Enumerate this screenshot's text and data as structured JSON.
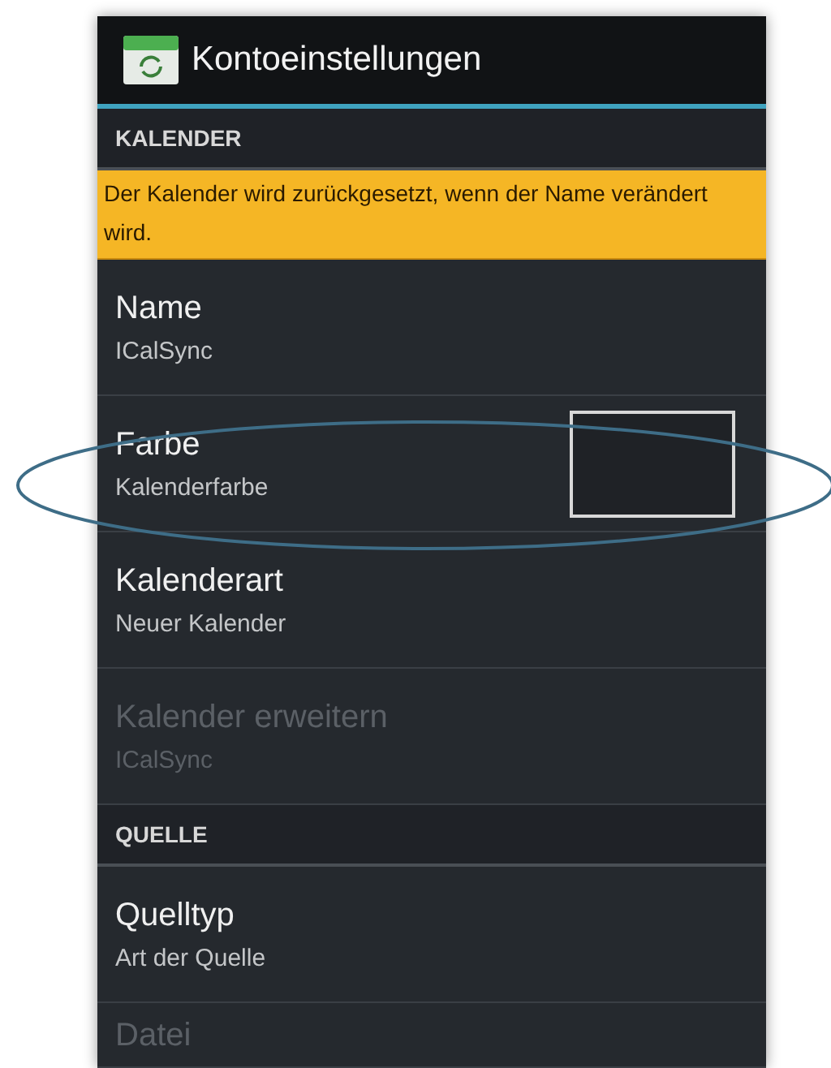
{
  "action_bar": {
    "title": "Kontoeinstellungen"
  },
  "sections": [
    {
      "header": "KALENDER",
      "notice": "Der Kalender wird zurückgesetzt, wenn der Name verändert wird.",
      "items": [
        {
          "kind": "text",
          "title": "Name",
          "summary": "ICalSync",
          "disabled": false
        },
        {
          "kind": "color",
          "title": "Farbe",
          "summary": "Kalenderfarbe",
          "disabled": false
        },
        {
          "kind": "text",
          "title": "Kalenderart",
          "summary": "Neuer Kalender",
          "disabled": false
        },
        {
          "kind": "text",
          "title": "Kalender erweitern",
          "summary": "ICalSync",
          "disabled": true
        }
      ]
    },
    {
      "header": "QUELLE",
      "items": [
        {
          "kind": "text",
          "title": "Quelltyp",
          "summary": "Art der Quelle",
          "disabled": false
        },
        {
          "kind": "text",
          "title": "Datei",
          "disabled": true
        }
      ]
    }
  ]
}
